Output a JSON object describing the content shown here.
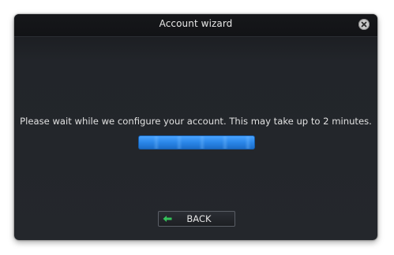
{
  "window": {
    "title": "Account wizard",
    "close_icon": "close-icon"
  },
  "content": {
    "message": "Please wait while we configure your account. This may take up to 2 minutes.",
    "progress": 1.0
  },
  "footer": {
    "back_label": "BACK",
    "back_icon": "back-arrow-icon"
  },
  "colors": {
    "accent": "#2a86e8",
    "back_icon": "#35c25a"
  }
}
